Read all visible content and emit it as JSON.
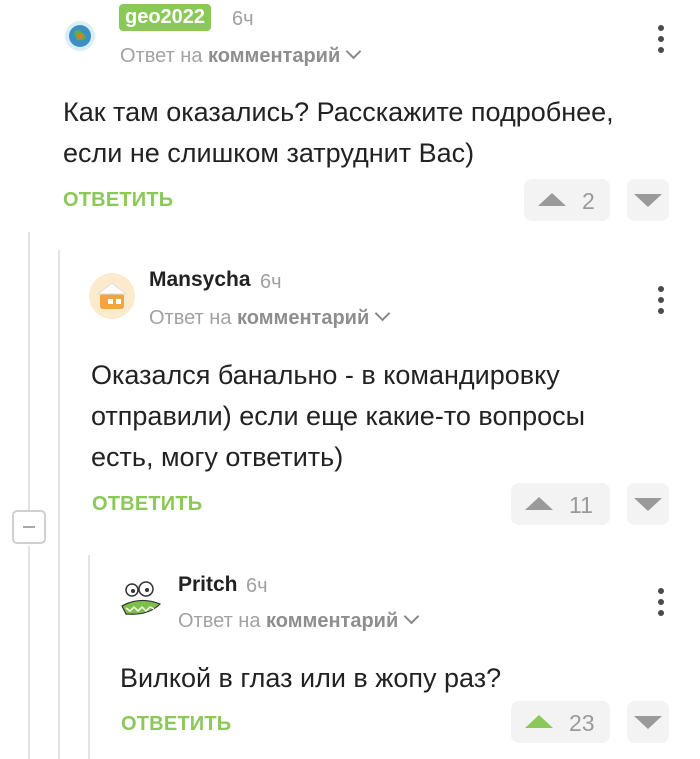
{
  "comments": [
    {
      "username": "geo2022",
      "time": "6ч",
      "reply_prefix": "Ответ на",
      "reply_target": "комментарий",
      "lines": [
        "Как там оказались? Расскажите подробнее,",
        "если не слишком затруднит Вас)"
      ],
      "reply_label": "ОТВЕТИТЬ",
      "votes": "2",
      "upvoted": false,
      "avatar_icon": "globe-icon"
    },
    {
      "username": "Mansycha",
      "time": "6ч",
      "reply_prefix": "Ответ на",
      "reply_target": "комментарий",
      "lines": [
        "Оказался банально - в командировку",
        "отправили) если еще какие-то вопросы",
        "есть, могу ответить)"
      ],
      "reply_label": "ОТВЕТИТЬ",
      "votes": "11",
      "upvoted": false,
      "avatar_icon": "cartoon-house-icon"
    },
    {
      "username": "Pritch",
      "time": "6ч",
      "reply_prefix": "Ответ на",
      "reply_target": "комментарий",
      "lines": [
        "Вилкой в глаз или в жопу раз?"
      ],
      "reply_label": "ОТВЕТИТЬ",
      "votes": "23",
      "upvoted": true,
      "avatar_icon": "cartoon-face-icon"
    }
  ],
  "colors": {
    "accent": "#8ac858",
    "muted": "#a0a0a0",
    "button_bg": "#f3f3f3"
  }
}
